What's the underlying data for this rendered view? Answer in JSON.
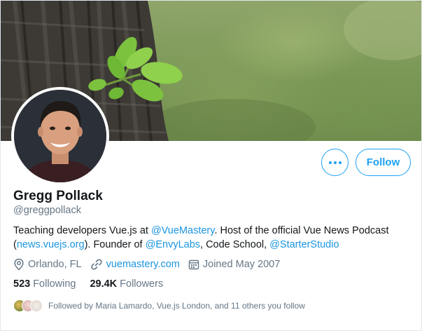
{
  "profile": {
    "name": "Gregg Pollack",
    "handle": "@greggpollack",
    "bio": {
      "t1": "Teaching developers Vue.js at ",
      "l1": "@VueMastery",
      "t2": ". Host of the official Vue News Podcast (",
      "l2": "news.vuejs.org",
      "t3": "). Founder of ",
      "l3": "@EnvyLabs",
      "t4": ", Code School, ",
      "l4": "@StarterStudio"
    },
    "location": "Orlando, FL",
    "website": "vuemastery.com",
    "joined": "Joined May 2007",
    "following_count": "523",
    "following_label": "Following",
    "followers_count": "29.4K",
    "followers_label": "Followers",
    "followed_by": "Followed by Maria Lamardo, Vue.js London, and 11 others you follow"
  },
  "actions": {
    "follow_label": "Follow",
    "more_icon": "more-dots-icon"
  },
  "colors": {
    "accent": "#1da1f2",
    "link": "#1b95e0",
    "secondary_text": "#657786",
    "primary_text": "#14171a"
  }
}
